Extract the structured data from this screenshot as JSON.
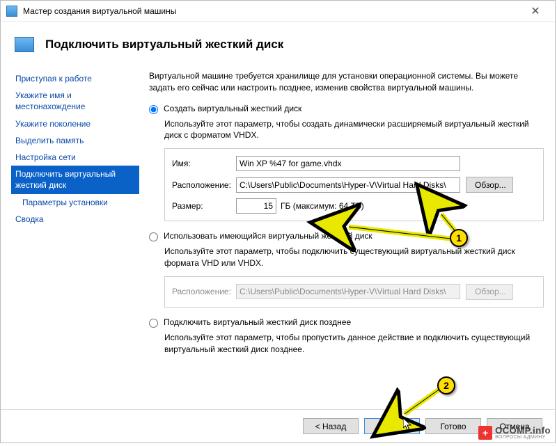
{
  "window": {
    "title": "Мастер создания виртуальной машины"
  },
  "header": {
    "title": "Подключить виртуальный жесткий диск"
  },
  "sidebar": {
    "items": [
      {
        "label": "Приступая к работе"
      },
      {
        "label": "Укажите имя и местонахождение"
      },
      {
        "label": "Укажите поколение"
      },
      {
        "label": "Выделить память"
      },
      {
        "label": "Настройка сети"
      },
      {
        "label": "Подключить виртуальный жесткий диск"
      },
      {
        "label": "Параметры установки"
      },
      {
        "label": "Сводка"
      }
    ]
  },
  "content": {
    "intro": "Виртуальной машине требуется хранилище для установки операционной системы. Вы можете задать его сейчас или настроить позднее, изменив свойства виртуальной машины.",
    "opt1": {
      "label": "Создать виртуальный жесткий диск",
      "desc": "Используйте этот параметр, чтобы создать динамически расширяемый виртуальный жесткий диск с форматом VHDX.",
      "name_label": "Имя:",
      "name_value": "Win XP %47 for game.vhdx",
      "loc_label": "Расположение:",
      "loc_value": "C:\\Users\\Public\\Documents\\Hyper-V\\Virtual Hard Disks\\",
      "browse": "Обзор...",
      "size_label": "Размер:",
      "size_value": "15",
      "size_unit": "ГБ (максимум: 64 ТБ)"
    },
    "opt2": {
      "label": "Использовать имеющийся виртуальный жесткий диск",
      "desc": "Используйте этот параметр, чтобы подключить существующий виртуальный жесткий диск формата VHD или VHDX.",
      "loc_label": "Расположение:",
      "loc_value": "C:\\Users\\Public\\Documents\\Hyper-V\\Virtual Hard Disks\\",
      "browse": "Обзор..."
    },
    "opt3": {
      "label": "Подключить виртуальный жесткий диск позднее",
      "desc": "Используйте этот параметр, чтобы пропустить данное действие и подключить существующий виртуальный жесткий диск позднее."
    }
  },
  "footer": {
    "back": "< Назад",
    "next": "Далее >",
    "finish": "Готово",
    "cancel": "Отмена"
  },
  "annotations": {
    "badge1": "1",
    "badge2": "2"
  },
  "watermark": {
    "main": "OCOMP.info",
    "sub": "ВОПРОСЫ АДМИНУ"
  }
}
